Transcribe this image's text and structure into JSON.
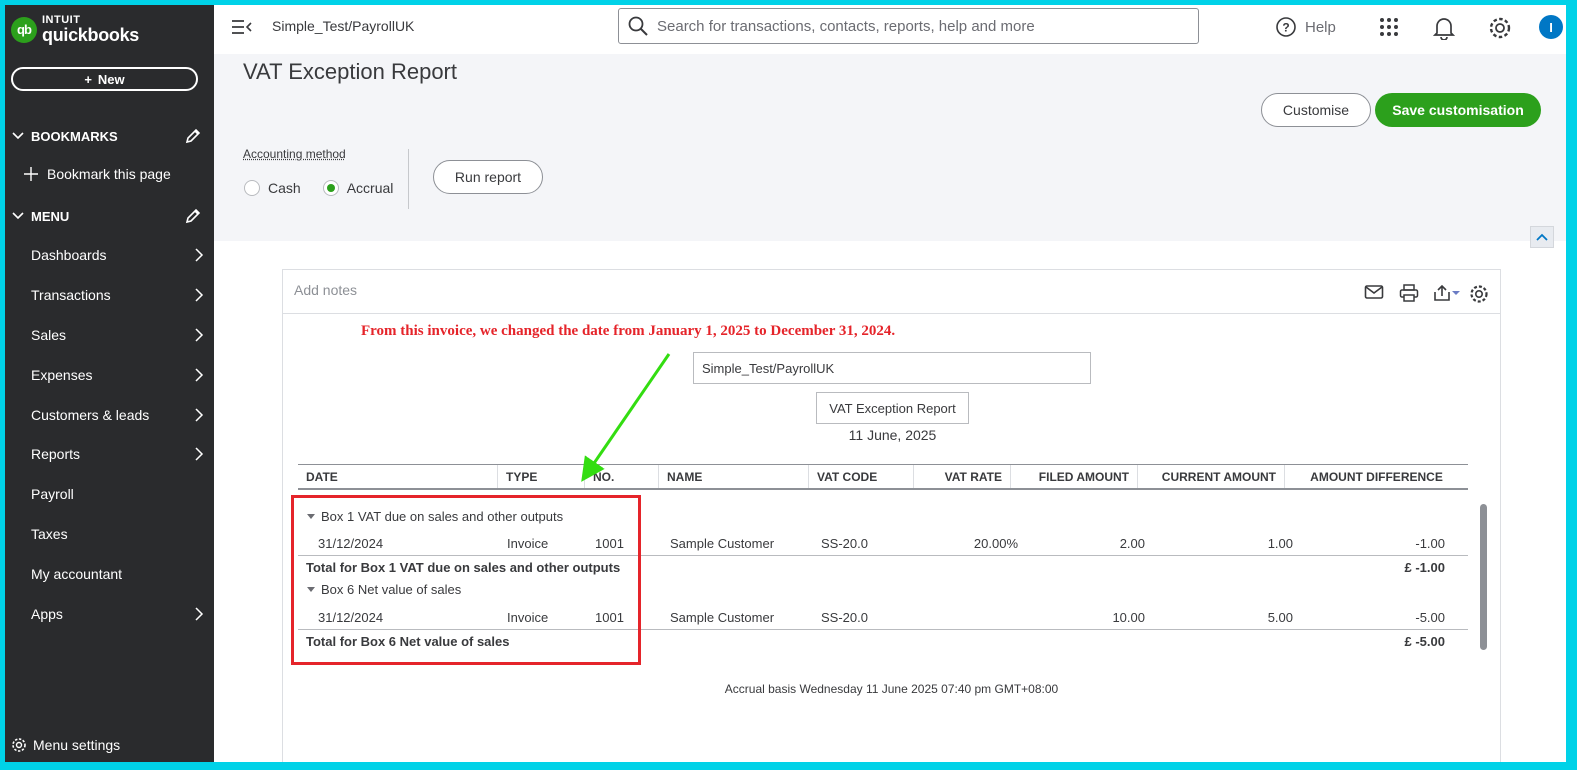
{
  "brand": {
    "intuit": "INTUIT",
    "product": "quickbooks",
    "mark": "qb"
  },
  "sidebar": {
    "new_label": "New",
    "bookmarks_label": "BOOKMARKS",
    "bookmark_page_label": "Bookmark this page",
    "menu_label": "MENU",
    "items": [
      {
        "label": "Dashboards",
        "has_arrow": true
      },
      {
        "label": "Transactions",
        "has_arrow": true
      },
      {
        "label": "Sales",
        "has_arrow": true
      },
      {
        "label": "Expenses",
        "has_arrow": true
      },
      {
        "label": "Customers & leads",
        "has_arrow": true
      },
      {
        "label": "Reports",
        "has_arrow": true
      },
      {
        "label": "Payroll",
        "has_arrow": false
      },
      {
        "label": "Taxes",
        "has_arrow": false
      },
      {
        "label": "My accountant",
        "has_arrow": false
      },
      {
        "label": "Apps",
        "has_arrow": true
      }
    ],
    "menu_settings_label": "Menu settings"
  },
  "topbar": {
    "company": "Simple_Test/PayrollUK",
    "search_placeholder": "Search for transactions, contacts, reports, help and more",
    "help_label": "Help",
    "avatar_initial": "I"
  },
  "header": {
    "title": "VAT Exception Report",
    "customise_label": "Customise",
    "save_label": "Save customisation",
    "accounting_method_label": "Accounting method",
    "cash_label": "Cash",
    "accrual_label": "Accrual",
    "selected_method": "Accrual",
    "run_report_label": "Run report"
  },
  "report": {
    "add_notes_placeholder": "Add notes",
    "annotation": "From this invoice, we changed the date from January 1, 2025 to December 31, 2024.",
    "company_name": "Simple_Test/PayrollUK",
    "report_title": "VAT Exception Report",
    "report_date": "11 June, 2025",
    "columns": [
      "DATE",
      "TYPE",
      "NO.",
      "NAME",
      "VAT CODE",
      "VAT RATE",
      "FILED AMOUNT",
      "CURRENT AMOUNT",
      "AMOUNT DIFFERENCE"
    ],
    "groups": [
      {
        "title": "Box 1 VAT due on sales and other outputs",
        "rows": [
          {
            "date": "31/12/2024",
            "type": "Invoice",
            "no": "1001",
            "name": "Sample Customer",
            "vat_code": "SS-20.0",
            "vat_rate": "20.00%",
            "filed": "2.00",
            "current": "1.00",
            "diff": "-1.00"
          }
        ],
        "total_label": "Total for Box 1 VAT due on sales and other outputs",
        "total_value": "£ -1.00"
      },
      {
        "title": "Box 6 Net value of sales",
        "rows": [
          {
            "date": "31/12/2024",
            "type": "Invoice",
            "no": "1001",
            "name": "Sample Customer",
            "vat_code": "SS-20.0",
            "vat_rate": "",
            "filed": "10.00",
            "current": "5.00",
            "diff": "-5.00"
          }
        ],
        "total_label": "Total for Box 6 Net value of sales",
        "total_value": "£ -5.00"
      }
    ],
    "footer": "Accrual basis  Wednesday 11 June 2025  07:40 pm GMT+08:00"
  },
  "colors": {
    "brand_green": "#2ca01c",
    "sidebar_bg": "#2a2b2d",
    "annotation_red": "#e5242a",
    "arrow_green": "#33dd11",
    "frame_cyan": "#00d2e8"
  }
}
